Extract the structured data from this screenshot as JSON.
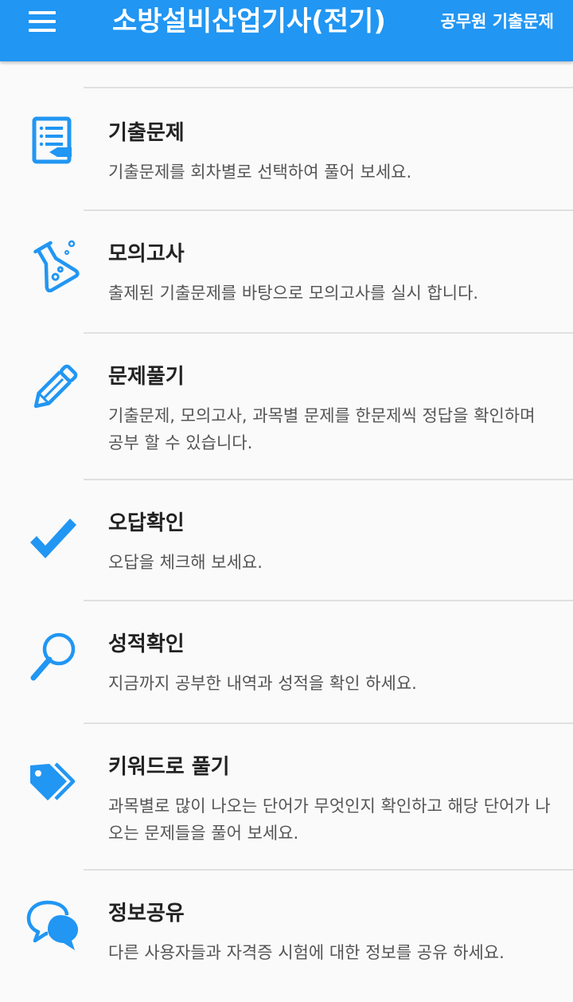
{
  "header": {
    "title": "소방설비산업기사(전기)",
    "action_label": "공무원 기출문제",
    "background": "#2196f3"
  },
  "accent_color": "#2196f3",
  "menu": [
    {
      "title": "기출문제",
      "description": "기출문제를 회차별로 선택하여 풀어 보세요.",
      "icon": "notebook-icon"
    },
    {
      "title": "모의고사",
      "description": "출제된 기출문제를 바탕으로 모의고사를 실시 합니다.",
      "icon": "flask-icon"
    },
    {
      "title": "문제풀기",
      "description": "기출문제, 모의고사, 과목별 문제를 한문제씩 정답을 확인하며 공부 할 수 있습니다.",
      "icon": "pencil-icon"
    },
    {
      "title": "오답확인",
      "description": "오답을 체크해 보세요.",
      "icon": "checkmark-icon"
    },
    {
      "title": "성적확인",
      "description": "지금까지 공부한 내역과 성적을 확인 하세요.",
      "icon": "magnifier-icon"
    },
    {
      "title": "키워드로 풀기",
      "description": "과목별로 많이 나오는 단어가 무엇인지 확인하고 해당 단어가 나오는 문제들을 풀어 보세요.",
      "icon": "tags-icon"
    },
    {
      "title": "정보공유",
      "description": "다른 사용자들과 자격증 시험에 대한 정보를 공유 하세요.",
      "icon": "chat-bubbles-icon"
    }
  ]
}
